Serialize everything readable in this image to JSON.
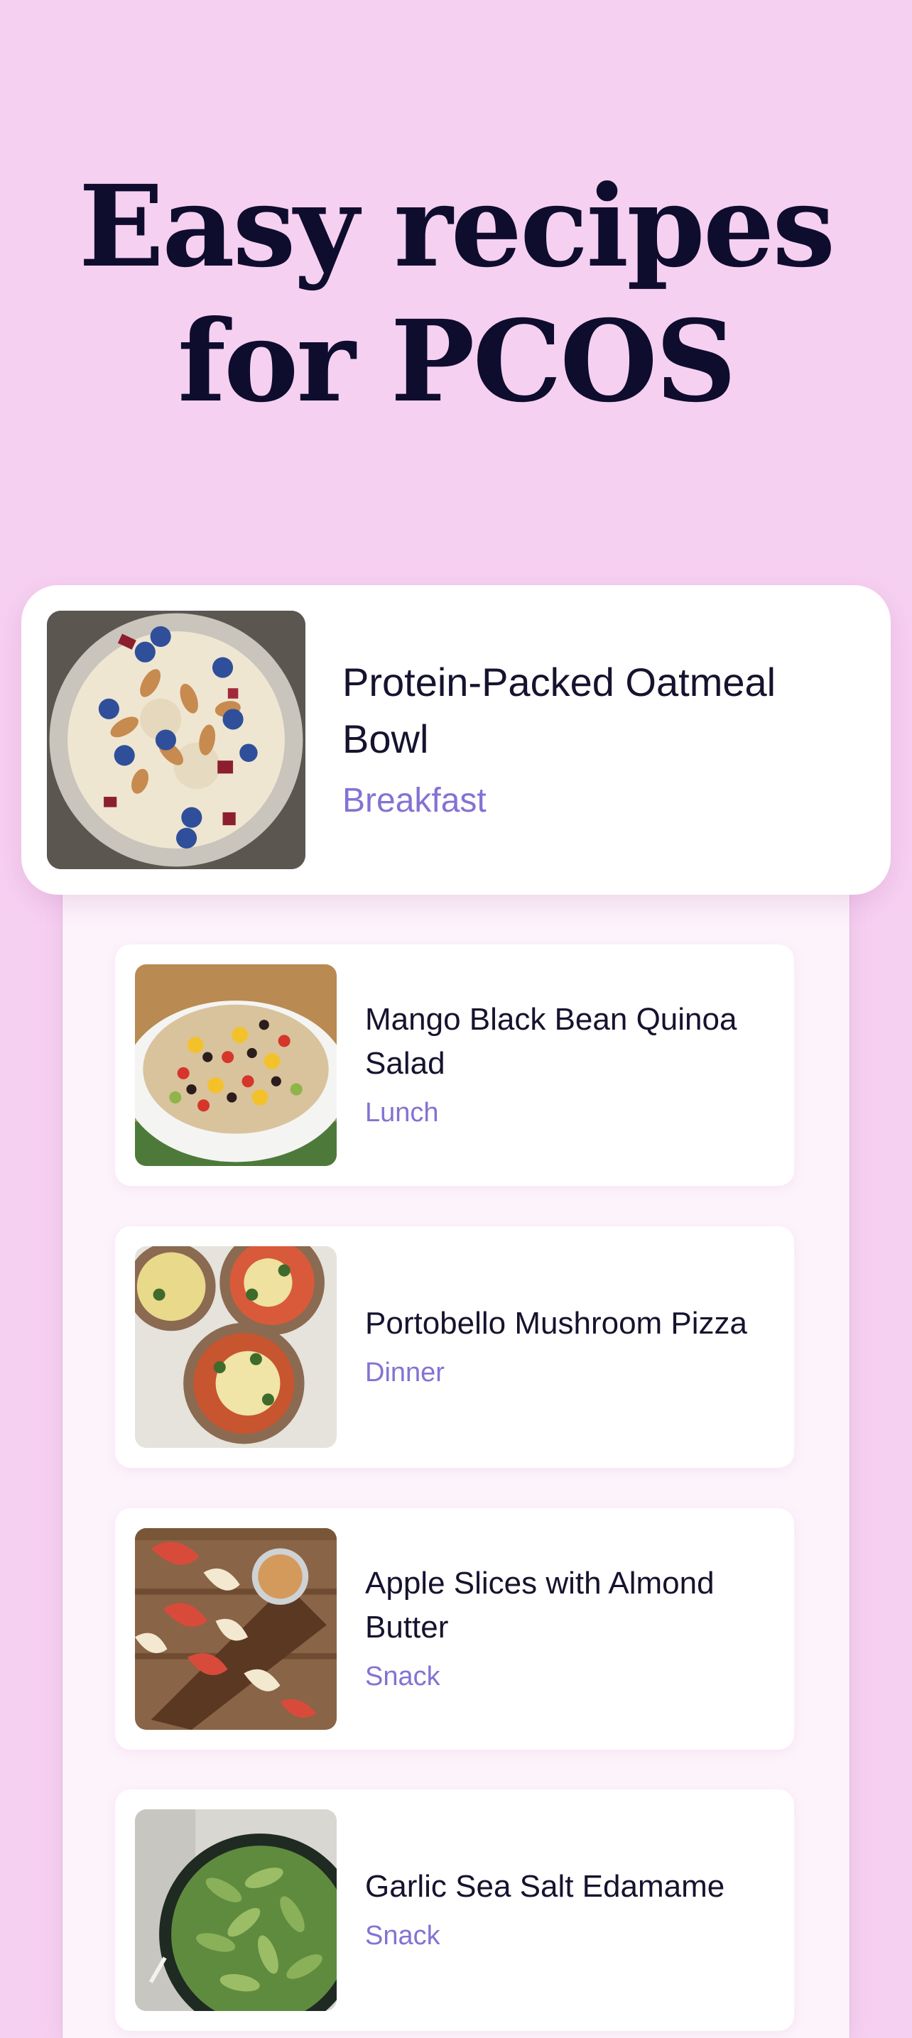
{
  "hero": {
    "line1": "Easy recipes",
    "line2": "for PCOS"
  },
  "featured": {
    "title": "Protein-Packed Oatmeal Bowl",
    "category": "Breakfast"
  },
  "recipes": [
    {
      "title": "Mango Black Bean Quinoa Salad",
      "category": "Lunch"
    },
    {
      "title": "Portobello Mushroom Pizza",
      "category": "Dinner"
    },
    {
      "title": "Apple Slices with Almond Butter",
      "category": "Snack"
    },
    {
      "title": "Garlic Sea Salt Edamame",
      "category": "Snack"
    }
  ],
  "colors": {
    "background": "#f6d0f1",
    "heading": "#0f0d2e",
    "category_accent": "#8572d3",
    "card": "#ffffff"
  }
}
